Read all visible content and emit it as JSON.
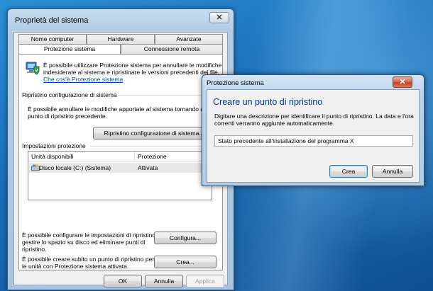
{
  "system_properties": {
    "title": "Proprietà del sistema",
    "close_label": "✕",
    "tabs": [
      {
        "label": "Nome computer"
      },
      {
        "label": "Hardware"
      },
      {
        "label": "Avanzate"
      },
      {
        "label": "Protezione sistema"
      },
      {
        "label": "Connessione remota"
      }
    ],
    "intro_text_1": "È possibile utilizzare Protezione sistema per annullare le modifiche",
    "intro_text_2": "indesiderate al sistema e ripristinare le versioni precedenti dei file.",
    "intro_link": "Che cos'è Protezione sistema",
    "restore_section_title": "Ripristino configurazione di sistema",
    "restore_text_1": "È possibile annullare le modifiche apportate al sistema tornando a un",
    "restore_text_2": "punto di ripristino precedente.",
    "restore_button": "Ripristino configurazione di sistema...",
    "protection_section_title": "Impostazioni protezione",
    "list_headers": {
      "drives": "Unità disponibili",
      "protection": "Protezione"
    },
    "drives": [
      {
        "name": "Disco locale (C:) (Sistema)",
        "protection": "Attivata"
      }
    ],
    "configure_text_1": "È possibile configurare le impostazioni di ripristino,",
    "configure_text_2": "gestire lo spazio su disco ed eliminare punti di",
    "configure_text_3": "ripristino.",
    "configure_button": "Configura...",
    "create_text_1": "È possibile creare subito un punto di ripristino per",
    "create_text_2": "le unità con Protezione sistema attivata.",
    "create_button": "Crea...",
    "ok_button": "OK",
    "cancel_button": "Annulla",
    "apply_button": "Applica"
  },
  "create_dialog": {
    "title": "Protezione sistema",
    "close_label": "✕",
    "heading": "Creare un punto di ripristino",
    "description_1": "Digitare una descrizione per identificare il punto di ripristino. La data e l'ora",
    "description_2": "correnti verranno aggiunte automaticamente.",
    "input_value": "Stato precedente all'installazione del programma X",
    "create_button": "Crea",
    "cancel_button": "Annulla"
  }
}
